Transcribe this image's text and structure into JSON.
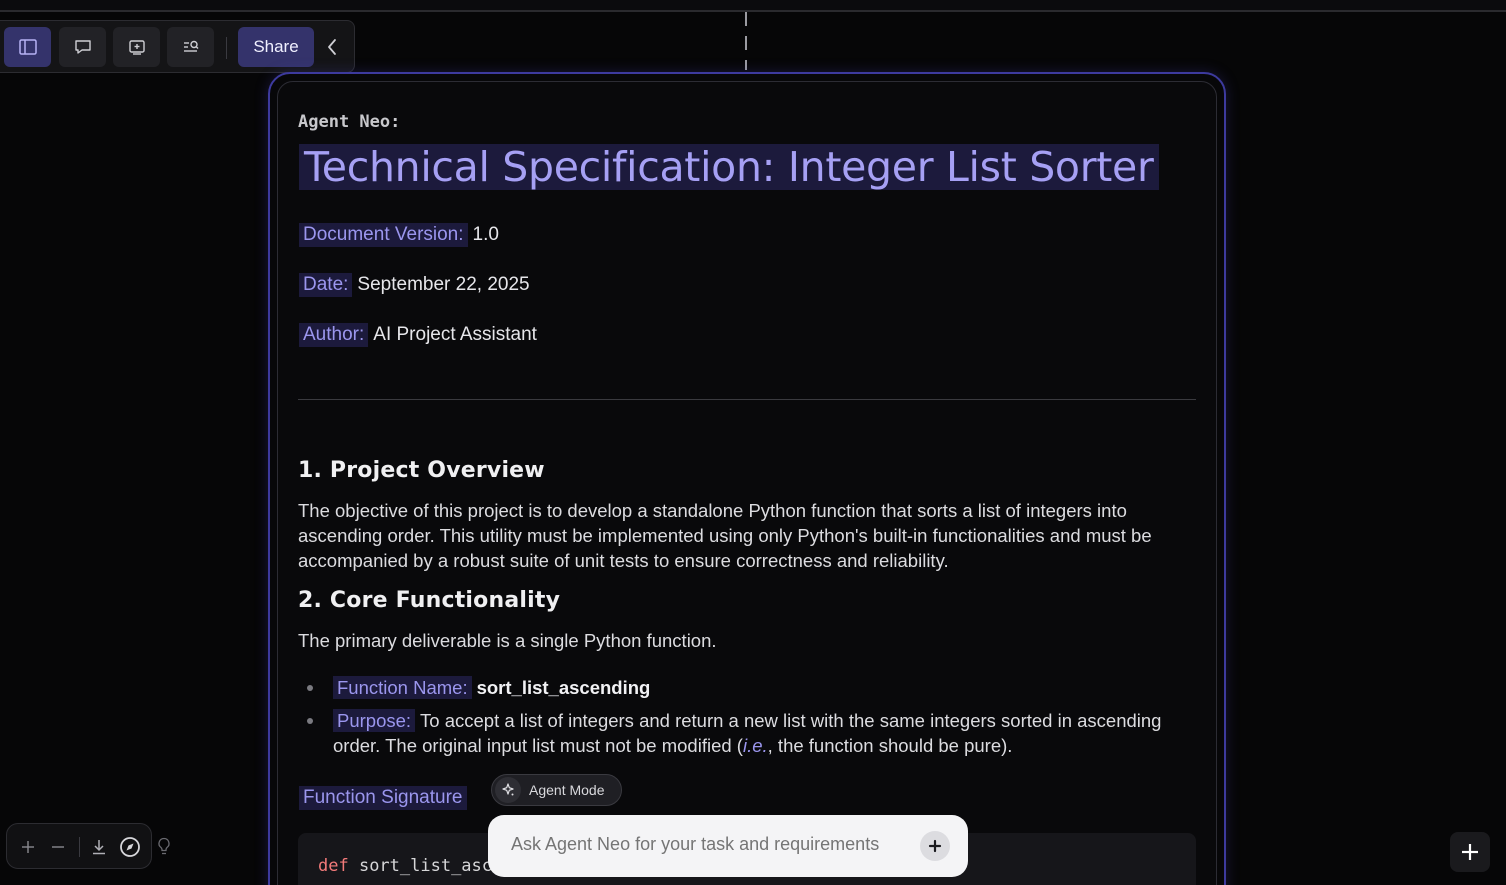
{
  "toolbar": {
    "buttons": [
      "sidebar-toggle",
      "comments",
      "add-slide",
      "search-list"
    ],
    "share_label": "Share"
  },
  "document": {
    "agent_label": "Agent Neo:",
    "title": "Technical Specification: Integer List Sorter",
    "meta": [
      {
        "label": "Document Version:",
        "value": "1.0"
      },
      {
        "label": "Date:",
        "value": "September 22, 2025"
      },
      {
        "label": "Author:",
        "value": "AI Project Assistant"
      }
    ],
    "sections": [
      {
        "heading": "1. Project Overview",
        "body": "The objective of this project is to develop a standalone Python function that sorts a list of integers into ascending order. This utility must be implemented using only Python's built-in functionalities and must be accompanied by a robust suite of unit tests to ensure correctness and reliability."
      },
      {
        "heading": "2. Core Functionality",
        "body": "The primary deliverable is a single Python function."
      }
    ],
    "function_name_label": "Function Name:",
    "function_name": "sort_list_ascending",
    "purpose_label": "Purpose:",
    "purpose_before": "To accept a list of integers and return a new list with the same integers sorted in ascending order. The original input list must not be modified (",
    "purpose_ie": "i.e.",
    "purpose_after": ", the function should be pure).",
    "signature_label": "Function Signature",
    "code_keyword": "def",
    "code_rest": " sort_list_asce"
  },
  "agent_mode_label": "Agent Mode",
  "ask": {
    "placeholder": "Ask Agent Neo for your task and requirements"
  },
  "colors": {
    "accent": "#3d3a9e",
    "highlight_bg": "#1c1a3c",
    "highlight_text": "#9b96ee",
    "background": "#060607"
  }
}
